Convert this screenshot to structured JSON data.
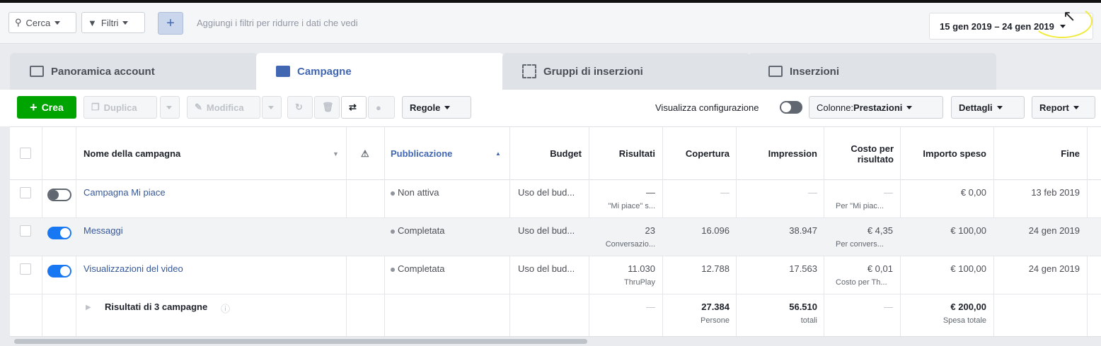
{
  "filterbar": {
    "search_label": "Cerca",
    "filters_label": "Filtri",
    "add_label": "+",
    "hint": "Aggiungi i filtri per ridurre i dati che vedi",
    "date_range": "15 gen 2019 – 24 gen 2019"
  },
  "tabs": [
    {
      "label": "Panoramica account"
    },
    {
      "label": "Campagne"
    },
    {
      "label": "Gruppi di inserzioni"
    },
    {
      "label": "Inserzioni"
    }
  ],
  "toolbar": {
    "create": "Crea",
    "duplicate": "Duplica",
    "edit": "Modifica",
    "rules": "Regole",
    "view_config": "Visualizza configurazione",
    "columns_prefix": "Colonne: ",
    "columns_value": "Prestazioni",
    "details": "Dettagli",
    "report": "Report"
  },
  "table": {
    "headers": {
      "name": "Nome della campagna",
      "delivery": "Pubblicazione",
      "budget": "Budget",
      "results": "Risultati",
      "reach": "Copertura",
      "impressions": "Impression",
      "cpr1": "Costo per",
      "cpr2": "risultato",
      "spent": "Importo speso",
      "end": "Fine"
    },
    "rows": [
      {
        "name": "Campagna Mi piace",
        "delivery": "Non attiva",
        "budget": "Uso del bud...",
        "results": "—",
        "results_sub": "\"Mi piace\" s...",
        "reach": "—",
        "impressions": "—",
        "cpr": "—",
        "cpr_sub": "Per \"Mi piac...",
        "spent": "€ 0,00",
        "end": "13 feb 2019"
      },
      {
        "name": "Messaggi",
        "delivery": "Completata",
        "budget": "Uso del bud...",
        "results": "23",
        "results_sub": "Conversazio...",
        "reach": "16.096",
        "impressions": "38.947",
        "cpr": "€ 4,35",
        "cpr_sub": "Per convers...",
        "spent": "€ 100,00",
        "end": "24 gen 2019"
      },
      {
        "name": "Visualizzazioni del video",
        "delivery": "Completata",
        "budget": "Uso del bud...",
        "results": "11.030",
        "results_sub": "ThruPlay",
        "reach": "12.788",
        "impressions": "17.563",
        "cpr": "€ 0,01",
        "cpr_sub": "Costo per Th...",
        "spent": "€ 100,00",
        "end": "24 gen 2019"
      }
    ],
    "summary": {
      "label": "Risultati di 3 campagne",
      "results": "—",
      "reach": "27.384",
      "reach_sub": "Persone",
      "impressions": "56.510",
      "impressions_sub": "totali",
      "cpr": "—",
      "spent": "€ 200,00",
      "spent_sub": "Spesa totale"
    }
  }
}
